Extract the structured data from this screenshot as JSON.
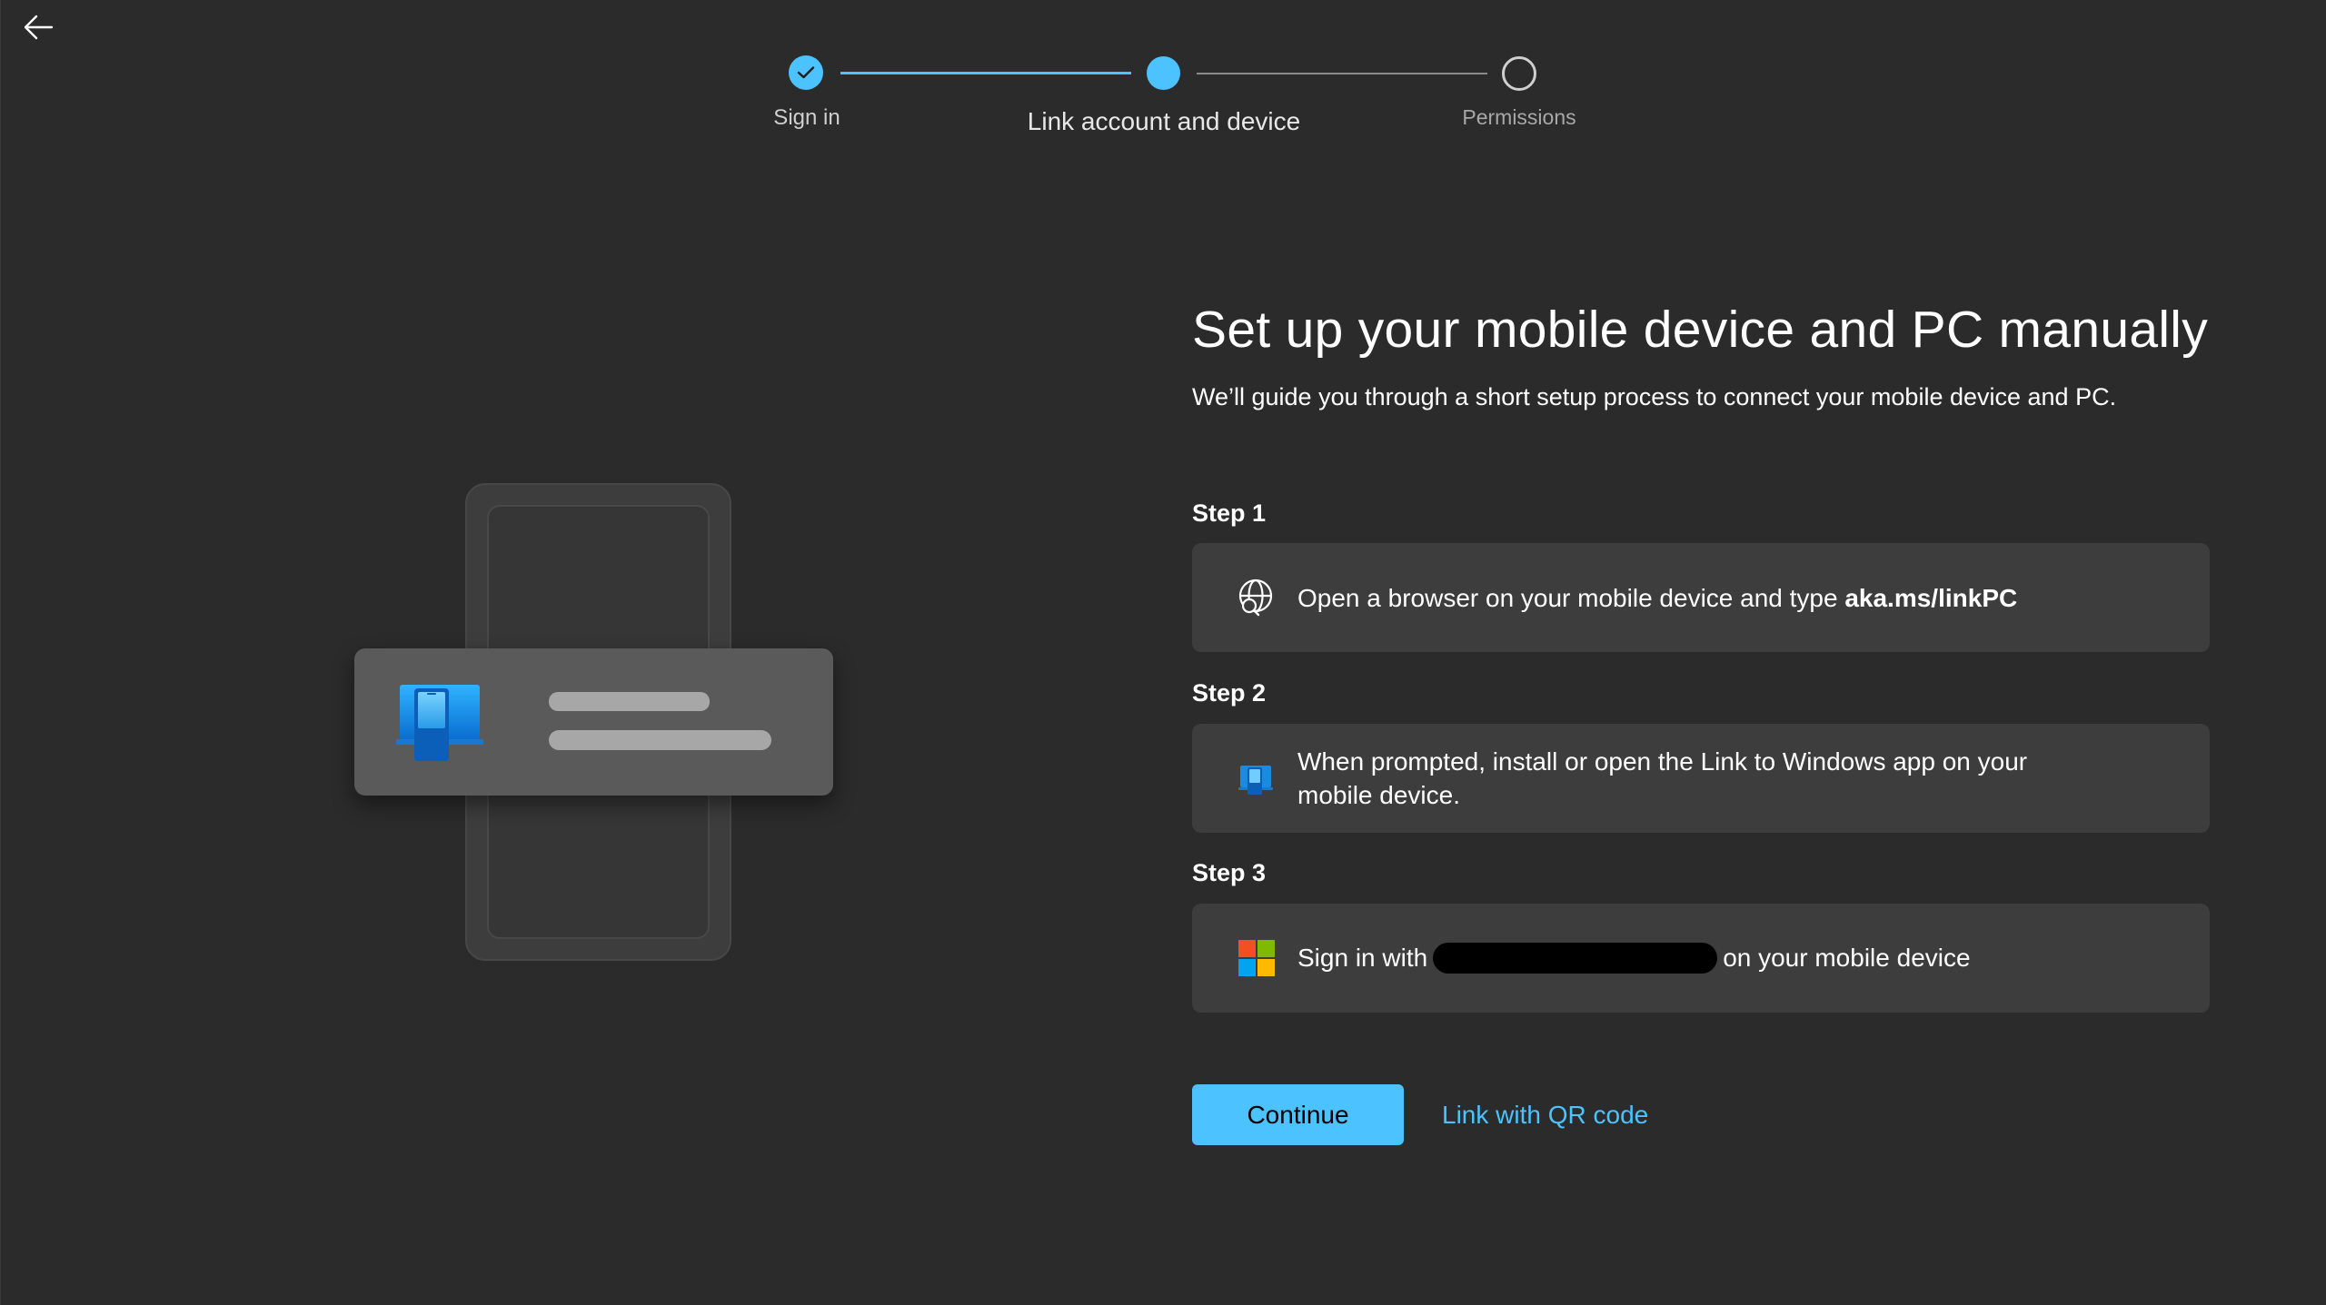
{
  "nav": {
    "back_icon": "arrow-left-icon"
  },
  "stepper": {
    "steps": [
      {
        "label": "Sign in",
        "state": "completed"
      },
      {
        "label": "Link account and device",
        "state": "current"
      },
      {
        "label": "Permissions",
        "state": "upcoming"
      }
    ],
    "accent_color": "#4cc2ff"
  },
  "main": {
    "title": "Set up your mobile device and PC manually",
    "subtitle": "We’ll guide you through a short setup process to connect your mobile device and PC.",
    "steps": [
      {
        "heading": "Step 1",
        "icon": "globe-search-icon",
        "text": "Open a browser on your mobile device and type ",
        "bold": "aka.ms/linkPC"
      },
      {
        "heading": "Step 2",
        "icon": "link-to-windows-app-icon",
        "text": "When prompted, install or open the Link to Windows app on your mobile device."
      },
      {
        "heading": "Step 3",
        "icon": "microsoft-logo-icon",
        "text_before": "Sign in with",
        "text_after": "on your mobile device"
      }
    ]
  },
  "actions": {
    "continue_label": "Continue",
    "qr_link_label": "Link with QR code"
  },
  "colors": {
    "background": "#2b2b2b",
    "card": "#3d3d3d",
    "accent": "#4cc2ff"
  }
}
